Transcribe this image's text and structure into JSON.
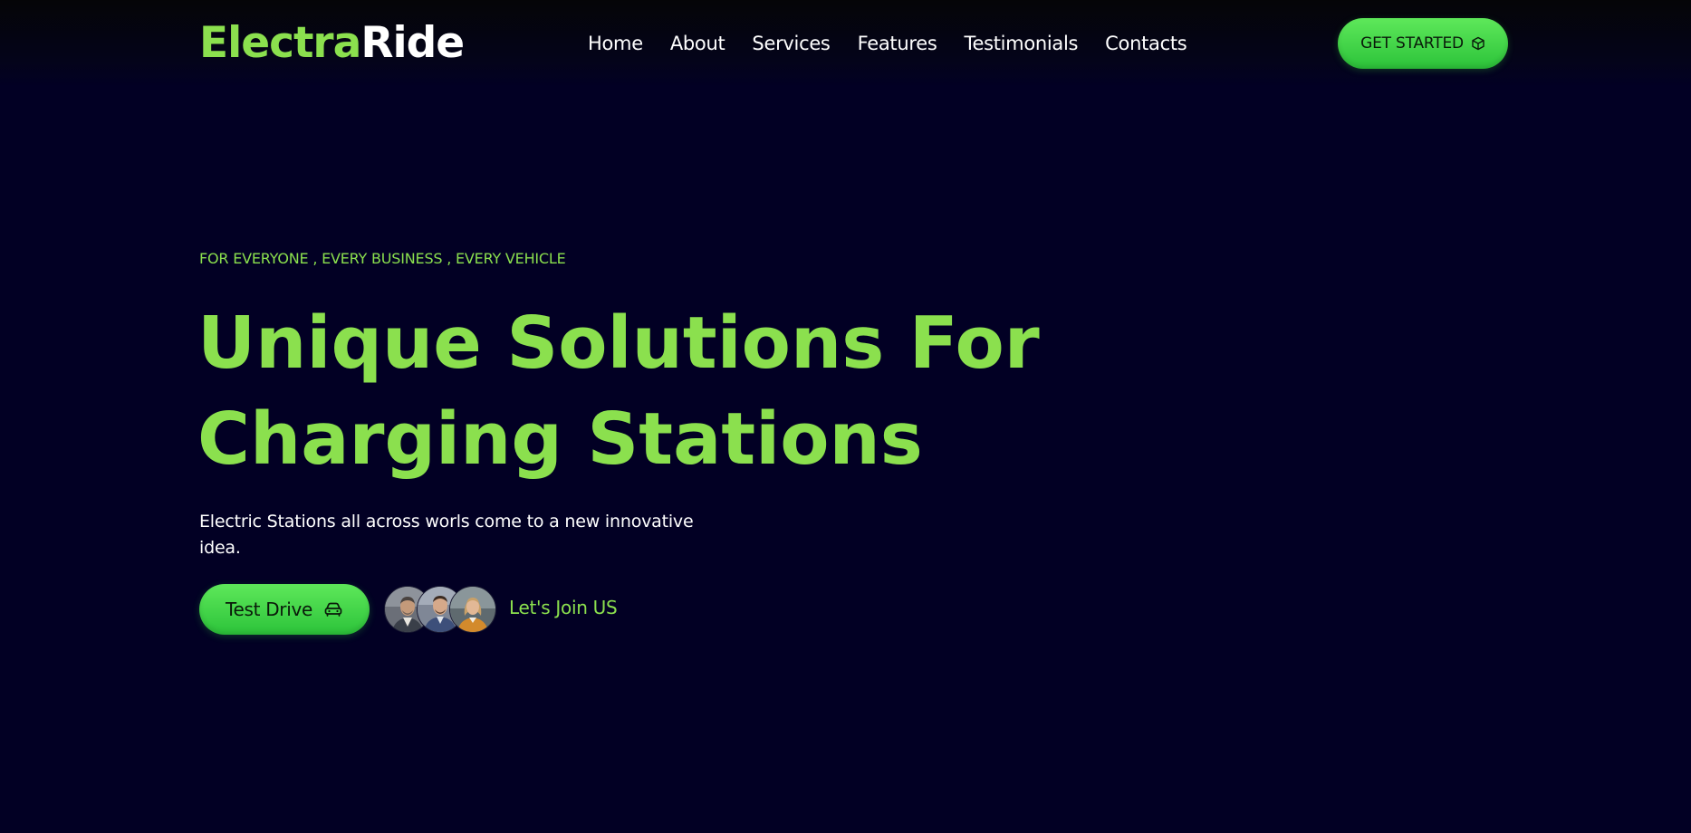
{
  "brand": {
    "name_part1": "Electra",
    "name_part2": "Ride",
    "accent_color": "#8be04e",
    "button_color": "#3fd24a",
    "background_color": "#020024"
  },
  "nav": {
    "items": [
      {
        "label": "Home"
      },
      {
        "label": "About"
      },
      {
        "label": "Services"
      },
      {
        "label": "Features"
      },
      {
        "label": "Testimonials"
      },
      {
        "label": "Contacts"
      }
    ]
  },
  "header": {
    "cta_label": "GET STARTED",
    "cta_icon": "cube-icon"
  },
  "hero": {
    "eyebrow": "FOR EVERYONE , EVERY BUSINESS , EVERY VEHICLE",
    "headline_line1": "Unique Solutions For",
    "headline_line2": "Charging Stations",
    "subtext": "Electric Stations all across worls come to a new innovative idea.",
    "primary_button_label": "Test Drive",
    "primary_button_icon": "car-icon",
    "join_label": "Let's Join US",
    "avatars": [
      {
        "name": "avatar-1"
      },
      {
        "name": "avatar-2"
      },
      {
        "name": "avatar-3"
      }
    ]
  }
}
